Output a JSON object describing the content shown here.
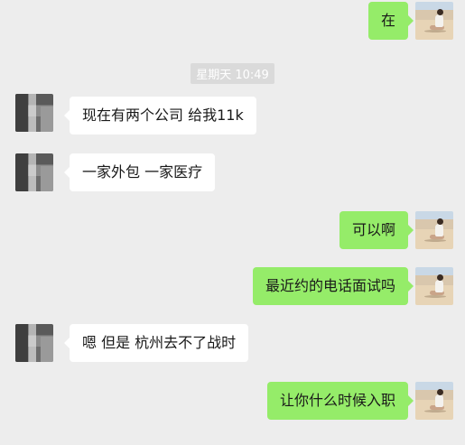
{
  "timestamp": "星期天 10:49",
  "messages": [
    {
      "side": "out",
      "text": "在"
    },
    {
      "side": "in",
      "text": "现在有两个公司 给我11k"
    },
    {
      "side": "in",
      "text": "一家外包 一家医疗"
    },
    {
      "side": "out",
      "text": "可以啊"
    },
    {
      "side": "out",
      "text": "最近约的电话面试吗"
    },
    {
      "side": "in",
      "text": "嗯 但是 杭州去不了战时"
    },
    {
      "side": "out",
      "text": "让你什么时候入职"
    }
  ],
  "colors": {
    "background": "#ededed",
    "incoming_bubble": "#ffffff",
    "outgoing_bubble": "#95ec69"
  },
  "icons": {
    "contact_avatar": "pixelated-avatar",
    "self_avatar": "beach-photo-avatar"
  }
}
